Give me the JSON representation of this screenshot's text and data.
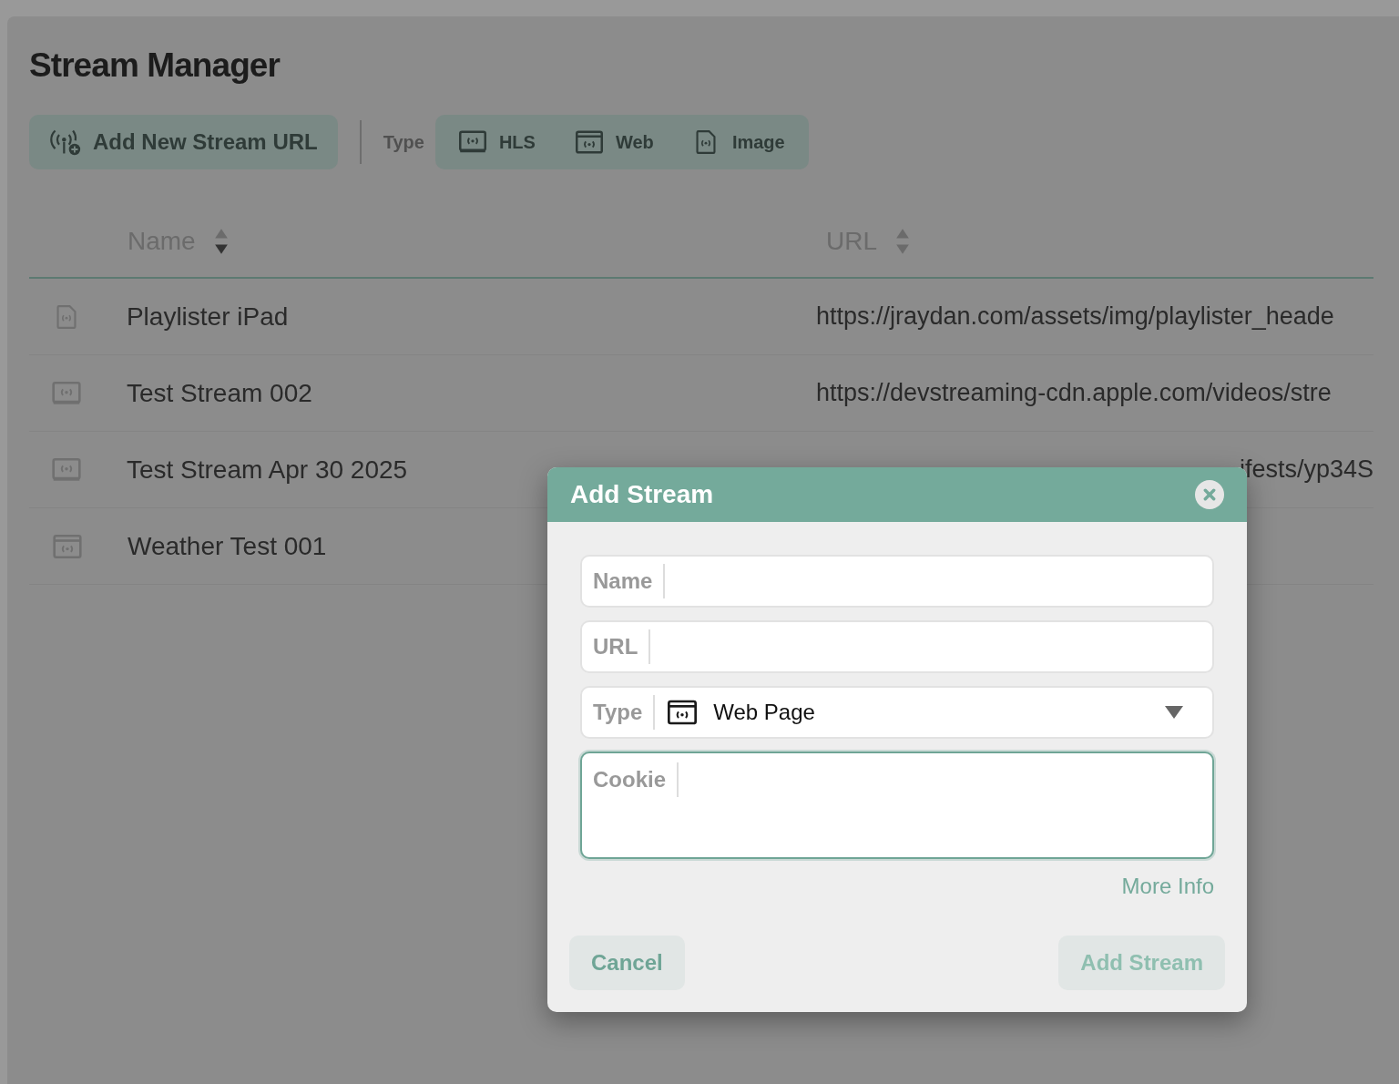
{
  "page": {
    "title": "Stream Manager"
  },
  "toolbar": {
    "add_button": "Add New Stream URL",
    "type_label": "Type",
    "type_filters": [
      {
        "label": "HLS",
        "kind": "hls"
      },
      {
        "label": "Web",
        "kind": "web"
      },
      {
        "label": "Image",
        "kind": "image"
      }
    ]
  },
  "table": {
    "columns": [
      {
        "label": "Name",
        "sorted": true
      },
      {
        "label": "URL",
        "sorted": false
      }
    ],
    "rows": [
      {
        "kind": "image",
        "name": "Playlister iPad",
        "url": "https://jraydan.com/assets/img/playlister_heade"
      },
      {
        "kind": "hls",
        "name": "Test Stream 002",
        "url": "https://devstreaming-cdn.apple.com/videos/stre"
      },
      {
        "kind": "hls",
        "name": "Test Stream Apr 30 2025",
        "url": "ifests/yp34S",
        "cut_at_start": true
      },
      {
        "kind": "web",
        "name": "Weather Test 001"
      }
    ]
  },
  "dialog": {
    "title": "Add Stream",
    "fields": [
      {
        "kind": "text",
        "label": "Name",
        "focused": false
      },
      {
        "kind": "text",
        "label": "URL",
        "focused": false
      },
      {
        "kind": "select",
        "label": "Type",
        "value": {
          "label": "Web Page",
          "kind": "web"
        },
        "focused": false
      },
      {
        "kind": "textarea",
        "label": "Cookie",
        "focused": true
      }
    ],
    "link": "More Info",
    "cancel_button": "Cancel",
    "submit_button": {
      "label": "Add Stream",
      "disabled": true
    }
  }
}
